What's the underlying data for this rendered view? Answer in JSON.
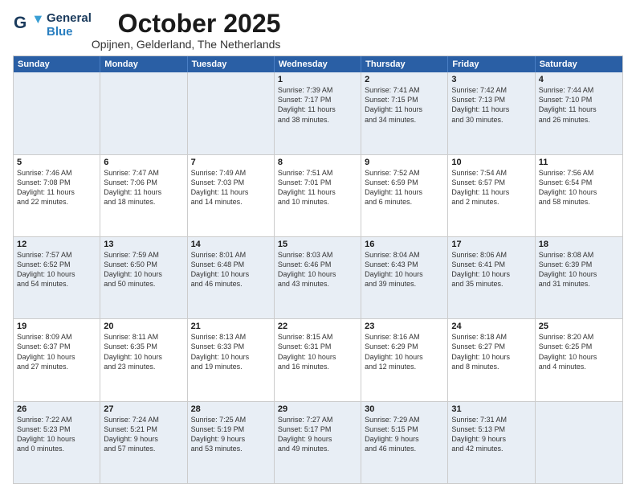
{
  "header": {
    "logo_general": "General",
    "logo_blue": "Blue",
    "month_title": "October 2025",
    "subtitle": "Opijnen, Gelderland, The Netherlands"
  },
  "weekdays": [
    "Sunday",
    "Monday",
    "Tuesday",
    "Wednesday",
    "Thursday",
    "Friday",
    "Saturday"
  ],
  "rows": [
    [
      {
        "day": "",
        "lines": []
      },
      {
        "day": "",
        "lines": []
      },
      {
        "day": "",
        "lines": []
      },
      {
        "day": "1",
        "lines": [
          "Sunrise: 7:39 AM",
          "Sunset: 7:17 PM",
          "Daylight: 11 hours",
          "and 38 minutes."
        ]
      },
      {
        "day": "2",
        "lines": [
          "Sunrise: 7:41 AM",
          "Sunset: 7:15 PM",
          "Daylight: 11 hours",
          "and 34 minutes."
        ]
      },
      {
        "day": "3",
        "lines": [
          "Sunrise: 7:42 AM",
          "Sunset: 7:13 PM",
          "Daylight: 11 hours",
          "and 30 minutes."
        ]
      },
      {
        "day": "4",
        "lines": [
          "Sunrise: 7:44 AM",
          "Sunset: 7:10 PM",
          "Daylight: 11 hours",
          "and 26 minutes."
        ]
      }
    ],
    [
      {
        "day": "5",
        "lines": [
          "Sunrise: 7:46 AM",
          "Sunset: 7:08 PM",
          "Daylight: 11 hours",
          "and 22 minutes."
        ]
      },
      {
        "day": "6",
        "lines": [
          "Sunrise: 7:47 AM",
          "Sunset: 7:06 PM",
          "Daylight: 11 hours",
          "and 18 minutes."
        ]
      },
      {
        "day": "7",
        "lines": [
          "Sunrise: 7:49 AM",
          "Sunset: 7:03 PM",
          "Daylight: 11 hours",
          "and 14 minutes."
        ]
      },
      {
        "day": "8",
        "lines": [
          "Sunrise: 7:51 AM",
          "Sunset: 7:01 PM",
          "Daylight: 11 hours",
          "and 10 minutes."
        ]
      },
      {
        "day": "9",
        "lines": [
          "Sunrise: 7:52 AM",
          "Sunset: 6:59 PM",
          "Daylight: 11 hours",
          "and 6 minutes."
        ]
      },
      {
        "day": "10",
        "lines": [
          "Sunrise: 7:54 AM",
          "Sunset: 6:57 PM",
          "Daylight: 11 hours",
          "and 2 minutes."
        ]
      },
      {
        "day": "11",
        "lines": [
          "Sunrise: 7:56 AM",
          "Sunset: 6:54 PM",
          "Daylight: 10 hours",
          "and 58 minutes."
        ]
      }
    ],
    [
      {
        "day": "12",
        "lines": [
          "Sunrise: 7:57 AM",
          "Sunset: 6:52 PM",
          "Daylight: 10 hours",
          "and 54 minutes."
        ]
      },
      {
        "day": "13",
        "lines": [
          "Sunrise: 7:59 AM",
          "Sunset: 6:50 PM",
          "Daylight: 10 hours",
          "and 50 minutes."
        ]
      },
      {
        "day": "14",
        "lines": [
          "Sunrise: 8:01 AM",
          "Sunset: 6:48 PM",
          "Daylight: 10 hours",
          "and 46 minutes."
        ]
      },
      {
        "day": "15",
        "lines": [
          "Sunrise: 8:03 AM",
          "Sunset: 6:46 PM",
          "Daylight: 10 hours",
          "and 43 minutes."
        ]
      },
      {
        "day": "16",
        "lines": [
          "Sunrise: 8:04 AM",
          "Sunset: 6:43 PM",
          "Daylight: 10 hours",
          "and 39 minutes."
        ]
      },
      {
        "day": "17",
        "lines": [
          "Sunrise: 8:06 AM",
          "Sunset: 6:41 PM",
          "Daylight: 10 hours",
          "and 35 minutes."
        ]
      },
      {
        "day": "18",
        "lines": [
          "Sunrise: 8:08 AM",
          "Sunset: 6:39 PM",
          "Daylight: 10 hours",
          "and 31 minutes."
        ]
      }
    ],
    [
      {
        "day": "19",
        "lines": [
          "Sunrise: 8:09 AM",
          "Sunset: 6:37 PM",
          "Daylight: 10 hours",
          "and 27 minutes."
        ]
      },
      {
        "day": "20",
        "lines": [
          "Sunrise: 8:11 AM",
          "Sunset: 6:35 PM",
          "Daylight: 10 hours",
          "and 23 minutes."
        ]
      },
      {
        "day": "21",
        "lines": [
          "Sunrise: 8:13 AM",
          "Sunset: 6:33 PM",
          "Daylight: 10 hours",
          "and 19 minutes."
        ]
      },
      {
        "day": "22",
        "lines": [
          "Sunrise: 8:15 AM",
          "Sunset: 6:31 PM",
          "Daylight: 10 hours",
          "and 16 minutes."
        ]
      },
      {
        "day": "23",
        "lines": [
          "Sunrise: 8:16 AM",
          "Sunset: 6:29 PM",
          "Daylight: 10 hours",
          "and 12 minutes."
        ]
      },
      {
        "day": "24",
        "lines": [
          "Sunrise: 8:18 AM",
          "Sunset: 6:27 PM",
          "Daylight: 10 hours",
          "and 8 minutes."
        ]
      },
      {
        "day": "25",
        "lines": [
          "Sunrise: 8:20 AM",
          "Sunset: 6:25 PM",
          "Daylight: 10 hours",
          "and 4 minutes."
        ]
      }
    ],
    [
      {
        "day": "26",
        "lines": [
          "Sunrise: 7:22 AM",
          "Sunset: 5:23 PM",
          "Daylight: 10 hours",
          "and 0 minutes."
        ]
      },
      {
        "day": "27",
        "lines": [
          "Sunrise: 7:24 AM",
          "Sunset: 5:21 PM",
          "Daylight: 9 hours",
          "and 57 minutes."
        ]
      },
      {
        "day": "28",
        "lines": [
          "Sunrise: 7:25 AM",
          "Sunset: 5:19 PM",
          "Daylight: 9 hours",
          "and 53 minutes."
        ]
      },
      {
        "day": "29",
        "lines": [
          "Sunrise: 7:27 AM",
          "Sunset: 5:17 PM",
          "Daylight: 9 hours",
          "and 49 minutes."
        ]
      },
      {
        "day": "30",
        "lines": [
          "Sunrise: 7:29 AM",
          "Sunset: 5:15 PM",
          "Daylight: 9 hours",
          "and 46 minutes."
        ]
      },
      {
        "day": "31",
        "lines": [
          "Sunrise: 7:31 AM",
          "Sunset: 5:13 PM",
          "Daylight: 9 hours",
          "and 42 minutes."
        ]
      },
      {
        "day": "",
        "lines": []
      }
    ]
  ],
  "alt_rows": [
    0,
    2,
    4
  ],
  "colors": {
    "header_bg": "#2a5fa5",
    "header_text": "#ffffff",
    "alt_bg": "#e8eef5",
    "border": "#cccccc"
  }
}
